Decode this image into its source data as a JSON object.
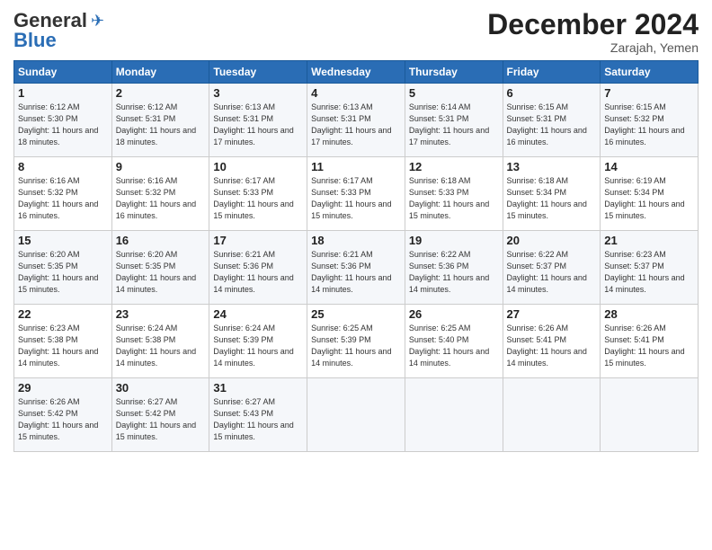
{
  "header": {
    "logo_general": "General",
    "logo_blue": "Blue",
    "title": "December 2024",
    "location": "Zarajah, Yemen"
  },
  "days_of_week": [
    "Sunday",
    "Monday",
    "Tuesday",
    "Wednesday",
    "Thursday",
    "Friday",
    "Saturday"
  ],
  "weeks": [
    [
      {
        "day": "1",
        "sunrise": "6:12 AM",
        "sunset": "5:30 PM",
        "daylight": "11 hours and 18 minutes."
      },
      {
        "day": "2",
        "sunrise": "6:12 AM",
        "sunset": "5:31 PM",
        "daylight": "11 hours and 18 minutes."
      },
      {
        "day": "3",
        "sunrise": "6:13 AM",
        "sunset": "5:31 PM",
        "daylight": "11 hours and 17 minutes."
      },
      {
        "day": "4",
        "sunrise": "6:13 AM",
        "sunset": "5:31 PM",
        "daylight": "11 hours and 17 minutes."
      },
      {
        "day": "5",
        "sunrise": "6:14 AM",
        "sunset": "5:31 PM",
        "daylight": "11 hours and 17 minutes."
      },
      {
        "day": "6",
        "sunrise": "6:15 AM",
        "sunset": "5:31 PM",
        "daylight": "11 hours and 16 minutes."
      },
      {
        "day": "7",
        "sunrise": "6:15 AM",
        "sunset": "5:32 PM",
        "daylight": "11 hours and 16 minutes."
      }
    ],
    [
      {
        "day": "8",
        "sunrise": "6:16 AM",
        "sunset": "5:32 PM",
        "daylight": "11 hours and 16 minutes."
      },
      {
        "day": "9",
        "sunrise": "6:16 AM",
        "sunset": "5:32 PM",
        "daylight": "11 hours and 16 minutes."
      },
      {
        "day": "10",
        "sunrise": "6:17 AM",
        "sunset": "5:33 PM",
        "daylight": "11 hours and 15 minutes."
      },
      {
        "day": "11",
        "sunrise": "6:17 AM",
        "sunset": "5:33 PM",
        "daylight": "11 hours and 15 minutes."
      },
      {
        "day": "12",
        "sunrise": "6:18 AM",
        "sunset": "5:33 PM",
        "daylight": "11 hours and 15 minutes."
      },
      {
        "day": "13",
        "sunrise": "6:18 AM",
        "sunset": "5:34 PM",
        "daylight": "11 hours and 15 minutes."
      },
      {
        "day": "14",
        "sunrise": "6:19 AM",
        "sunset": "5:34 PM",
        "daylight": "11 hours and 15 minutes."
      }
    ],
    [
      {
        "day": "15",
        "sunrise": "6:20 AM",
        "sunset": "5:35 PM",
        "daylight": "11 hours and 15 minutes."
      },
      {
        "day": "16",
        "sunrise": "6:20 AM",
        "sunset": "5:35 PM",
        "daylight": "11 hours and 14 minutes."
      },
      {
        "day": "17",
        "sunrise": "6:21 AM",
        "sunset": "5:36 PM",
        "daylight": "11 hours and 14 minutes."
      },
      {
        "day": "18",
        "sunrise": "6:21 AM",
        "sunset": "5:36 PM",
        "daylight": "11 hours and 14 minutes."
      },
      {
        "day": "19",
        "sunrise": "6:22 AM",
        "sunset": "5:36 PM",
        "daylight": "11 hours and 14 minutes."
      },
      {
        "day": "20",
        "sunrise": "6:22 AM",
        "sunset": "5:37 PM",
        "daylight": "11 hours and 14 minutes."
      },
      {
        "day": "21",
        "sunrise": "6:23 AM",
        "sunset": "5:37 PM",
        "daylight": "11 hours and 14 minutes."
      }
    ],
    [
      {
        "day": "22",
        "sunrise": "6:23 AM",
        "sunset": "5:38 PM",
        "daylight": "11 hours and 14 minutes."
      },
      {
        "day": "23",
        "sunrise": "6:24 AM",
        "sunset": "5:38 PM",
        "daylight": "11 hours and 14 minutes."
      },
      {
        "day": "24",
        "sunrise": "6:24 AM",
        "sunset": "5:39 PM",
        "daylight": "11 hours and 14 minutes."
      },
      {
        "day": "25",
        "sunrise": "6:25 AM",
        "sunset": "5:39 PM",
        "daylight": "11 hours and 14 minutes."
      },
      {
        "day": "26",
        "sunrise": "6:25 AM",
        "sunset": "5:40 PM",
        "daylight": "11 hours and 14 minutes."
      },
      {
        "day": "27",
        "sunrise": "6:26 AM",
        "sunset": "5:41 PM",
        "daylight": "11 hours and 14 minutes."
      },
      {
        "day": "28",
        "sunrise": "6:26 AM",
        "sunset": "5:41 PM",
        "daylight": "11 hours and 15 minutes."
      }
    ],
    [
      {
        "day": "29",
        "sunrise": "6:26 AM",
        "sunset": "5:42 PM",
        "daylight": "11 hours and 15 minutes."
      },
      {
        "day": "30",
        "sunrise": "6:27 AM",
        "sunset": "5:42 PM",
        "daylight": "11 hours and 15 minutes."
      },
      {
        "day": "31",
        "sunrise": "6:27 AM",
        "sunset": "5:43 PM",
        "daylight": "11 hours and 15 minutes."
      },
      null,
      null,
      null,
      null
    ]
  ],
  "labels": {
    "sunrise": "Sunrise:",
    "sunset": "Sunset:",
    "daylight": "Daylight:"
  }
}
